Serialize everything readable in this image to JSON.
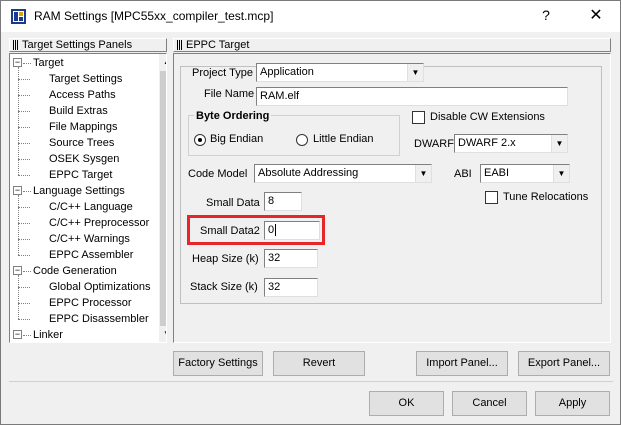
{
  "window": {
    "title": "RAM Settings [MPC55xx_compiler_test.mcp]",
    "help_glyph": "?",
    "close_glyph": "✕"
  },
  "tree_panel": {
    "header": "Target Settings Panels",
    "items": [
      {
        "label": "Target",
        "level": 0,
        "expander": "−"
      },
      {
        "label": "Target Settings",
        "level": 1
      },
      {
        "label": "Access Paths",
        "level": 1
      },
      {
        "label": "Build Extras",
        "level": 1
      },
      {
        "label": "File Mappings",
        "level": 1
      },
      {
        "label": "Source Trees",
        "level": 1
      },
      {
        "label": "OSEK Sysgen",
        "level": 1
      },
      {
        "label": "EPPC Target",
        "level": 1
      },
      {
        "label": "Language Settings",
        "level": 0,
        "expander": "−"
      },
      {
        "label": "C/C++ Language",
        "level": 1
      },
      {
        "label": "C/C++ Preprocessor",
        "level": 1
      },
      {
        "label": "C/C++ Warnings",
        "level": 1
      },
      {
        "label": "EPPC Assembler",
        "level": 1
      },
      {
        "label": "Code Generation",
        "level": 0,
        "expander": "−"
      },
      {
        "label": "Global Optimizations",
        "level": 1
      },
      {
        "label": "EPPC Processor",
        "level": 1
      },
      {
        "label": "EPPC Disassembler",
        "level": 1
      },
      {
        "label": "Linker",
        "level": 0,
        "expander": "−"
      }
    ],
    "scroll_up": "▲",
    "scroll_down": "▼"
  },
  "content_panel": {
    "header": "EPPC Target",
    "project_type_label": "Project Type",
    "project_type_value": "Application",
    "file_name_label": "File Name",
    "file_name_value": "RAM.elf",
    "byte_ordering_title": "Byte Ordering",
    "big_endian_label": "Big Endian",
    "little_endian_label": "Little Endian",
    "byte_ordering_selected": "Big Endian",
    "disable_cw_label": "Disable CW Extensions",
    "disable_cw_checked": false,
    "dwarf_label": "DWARF",
    "dwarf_value": "DWARF 2.x",
    "code_model_label": "Code Model",
    "code_model_value": "Absolute Addressing",
    "abi_label": "ABI",
    "abi_value": "EABI",
    "tune_relocations_label": "Tune Relocations",
    "tune_relocations_checked": false,
    "small_data_label": "Small Data",
    "small_data_value": "8",
    "small_data2_label": "Small Data2",
    "small_data2_value": "0",
    "heap_size_label": "Heap Size (k)",
    "heap_size_value": "32",
    "stack_size_label": "Stack Size (k)",
    "stack_size_value": "32",
    "dropdown_arrow": "▼"
  },
  "panel_buttons": {
    "factory_settings": "Factory Settings",
    "revert": "Revert",
    "import_panel": "Import Panel...",
    "export_panel": "Export Panel..."
  },
  "dialog_buttons": {
    "ok": "OK",
    "cancel": "Cancel",
    "apply": "Apply"
  },
  "colors": {
    "highlight": "#e8262a",
    "window_bg": "#f0f0f0"
  }
}
